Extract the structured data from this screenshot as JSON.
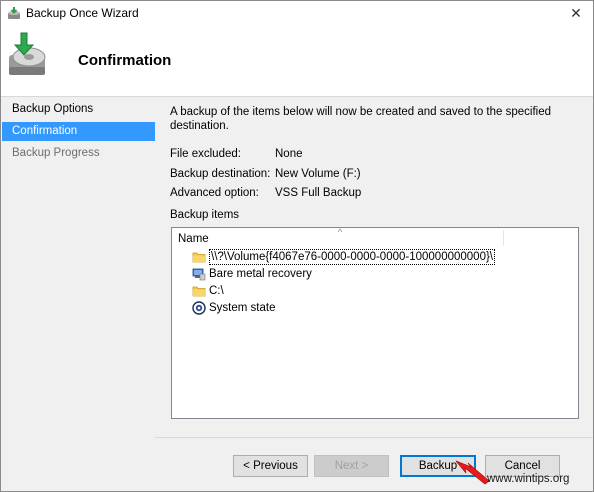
{
  "window": {
    "title": "Backup Once Wizard",
    "close_glyph": "✕"
  },
  "header": {
    "title": "Confirmation"
  },
  "nav": {
    "items": [
      {
        "label": "Backup Options",
        "state": "done"
      },
      {
        "label": "Confirmation",
        "state": "active"
      },
      {
        "label": "Backup Progress",
        "state": "pending"
      }
    ]
  },
  "content": {
    "description": "A backup of the items below will now be created and saved to the specified destination.",
    "rows": [
      {
        "label": "File excluded:",
        "value": "None"
      },
      {
        "label": "Backup destination:",
        "value": "New Volume (F:)"
      },
      {
        "label": "Advanced option:",
        "value": "VSS Full Backup"
      }
    ],
    "items_label": "Backup items",
    "list": {
      "column": "Name",
      "sort_glyph": "^",
      "items": [
        {
          "label": "\\\\?\\Volume{f4067e76-0000-0000-0000-100000000000}\\",
          "icon": "folder-icon"
        },
        {
          "label": "Bare metal recovery",
          "icon": "bare-metal-icon"
        },
        {
          "label": "C:\\",
          "icon": "folder-icon"
        },
        {
          "label": "System state",
          "icon": "system-state-icon"
        }
      ]
    }
  },
  "buttons": {
    "previous": "< Previous",
    "next": "Next >",
    "backup": "Backup",
    "cancel": "Cancel"
  },
  "watermark": "www.wintips.org",
  "colors": {
    "accent": "#3399ff",
    "default_border": "#0078d7",
    "arrow": "#e41c1c"
  }
}
